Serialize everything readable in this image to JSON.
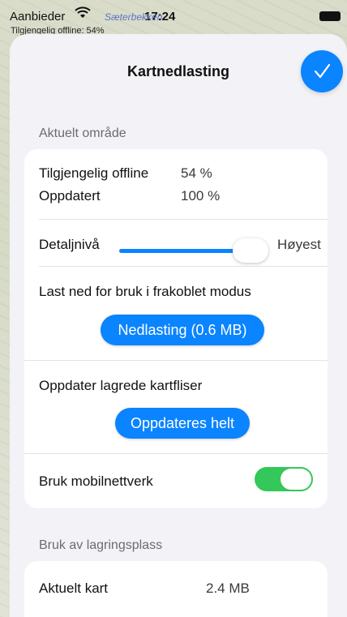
{
  "statusbar": {
    "carrier": "Aanbieder",
    "time": "17:24",
    "wifi_icon": "wifi-icon",
    "battery_icon": "battery-icon"
  },
  "map": {
    "place": "Sæterbekken",
    "offline_label": "Tilgjengelig offline: 54%"
  },
  "sheet": {
    "title": "Kartnedlasting",
    "done_icon": "checkmark-icon"
  },
  "current_area": {
    "header": "Aktuelt område",
    "offline_label": "Tilgjengelig offline",
    "offline_value": "54 %",
    "updated_label": "Oppdatert",
    "updated_value": "100 %",
    "detail_label": "Detaljnivå",
    "detail_value": "Høyest",
    "detail_level": 1.0,
    "download_label": "Last ned for bruk i frakoblet modus",
    "download_button": "Nedlasting (0.6 MB)",
    "update_label": "Oppdater lagrede kartfliser",
    "update_button": "Oppdateres helt",
    "mobile_label": "Bruk mobilnettverk",
    "mobile_enabled": true
  },
  "storage": {
    "header": "Bruk av lagringsplass",
    "current_map_label": "Aktuelt kart",
    "current_map_value": "2.4 MB"
  },
  "colors": {
    "accent": "#0a84ff",
    "toggle_on": "#34c759"
  }
}
